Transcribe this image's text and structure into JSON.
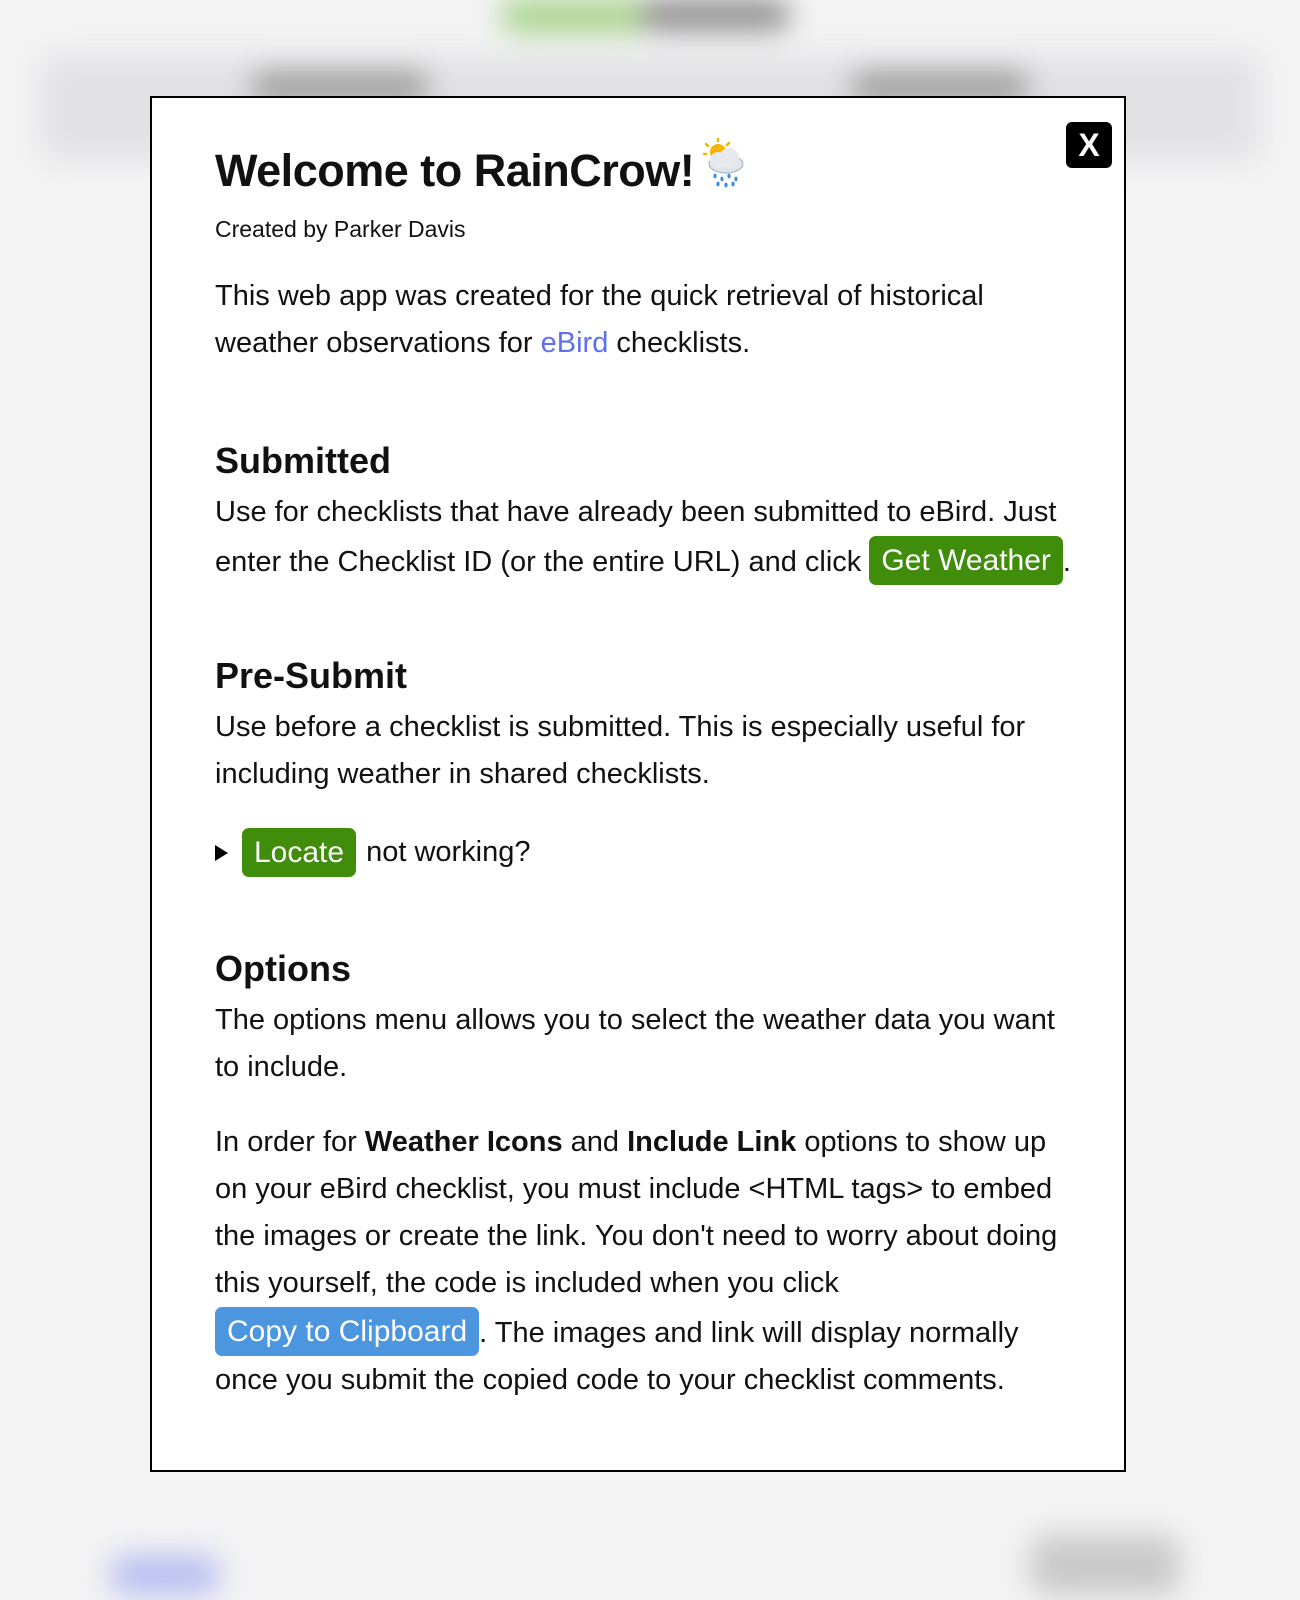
{
  "modal": {
    "close_label": "X",
    "title": "Welcome to RainCrow!",
    "title_icon": "cloud-with-rain-and-sun-icon",
    "credit": "Created by Parker Davis",
    "intro": {
      "text_before": "This web app was created for the quick retrieval of historical weather observations for ",
      "link": "eBird",
      "text_after": " checklists."
    },
    "submitted": {
      "heading": "Submitted",
      "text": "Use for checklists that have already been submitted to eBird. Just enter the Checklist ID (or the entire URL) and click ",
      "button": "Get Weather",
      "after": "."
    },
    "presubmit": {
      "heading": "Pre-Submit",
      "text": "Use before a checklist is submitted. This is especially useful for including weather in shared checklists.",
      "details_button": "Locate",
      "details_after": "not working?"
    },
    "options": {
      "heading": "Options",
      "text": "The options menu allows you to select the weather data you want to include.",
      "p2_a": "In order for ",
      "p2_bold1": "Weather Icons",
      "p2_b": " and ",
      "p2_bold2": "Include Link",
      "p2_c": " options to show up on your eBird checklist, you must include <HTML tags> to embed the images or create the link. You don't need to worry about doing this yourself, the code is included when you click ",
      "p2_button": "Copy to Clipboard",
      "p2_d": ". The images and link will display normally once you submit the copied code to your checklist comments."
    }
  },
  "colors": {
    "green_button": "#3f8d0b",
    "blue_button": "#4c95df",
    "link": "#5f6ff0"
  }
}
